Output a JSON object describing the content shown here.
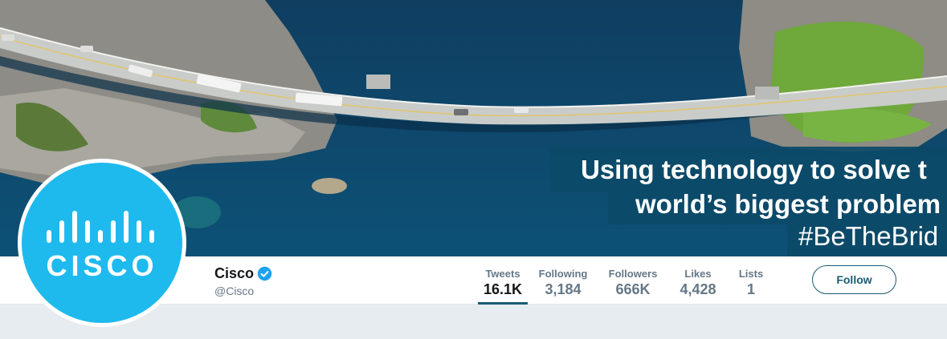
{
  "banner": {
    "headline_line1": "Using technology to solve t",
    "headline_line2": "world’s biggest problem",
    "headline_line3": "#BeTheBrid"
  },
  "profile": {
    "name": "Cisco",
    "handle": "@Cisco",
    "avatar_logo_text": "CISCO",
    "verified_icon": "verified-badge-icon",
    "brand_color": "#1ebaee"
  },
  "stats": [
    {
      "label": "Tweets",
      "value": "16.1K",
      "active": true
    },
    {
      "label": "Following",
      "value": "3,184",
      "active": false
    },
    {
      "label": "Followers",
      "value": "666K",
      "active": false
    },
    {
      "label": "Likes",
      "value": "4,428",
      "active": false
    },
    {
      "label": "Lists",
      "value": "1",
      "active": false
    }
  ],
  "actions": {
    "follow_label": "Follow"
  },
  "colors": {
    "accent": "#1a5c73",
    "verified": "#1da1f2",
    "water": "#0e3e62",
    "page_bg": "#e6ecf0"
  }
}
